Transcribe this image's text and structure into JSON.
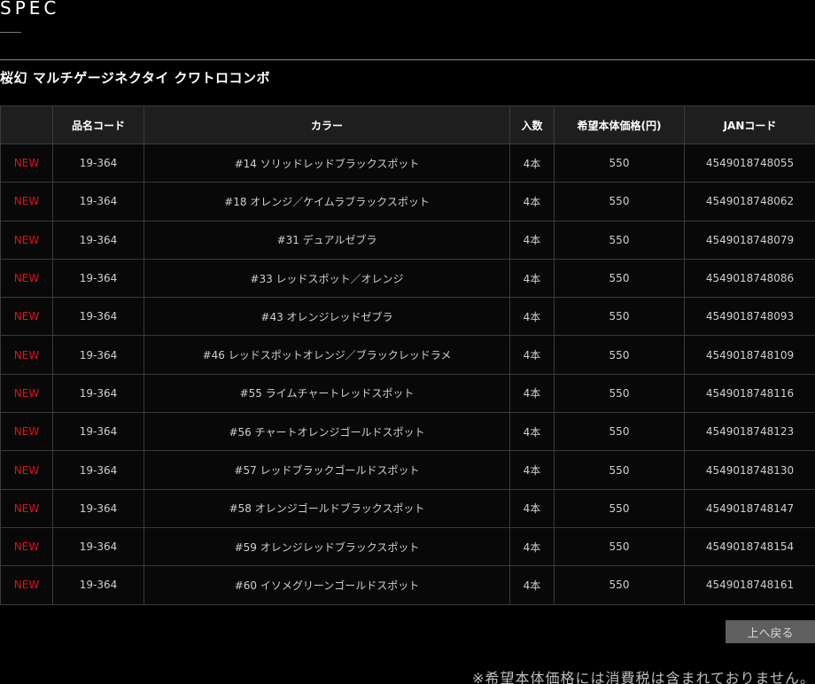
{
  "section": {
    "heading": "SPEC"
  },
  "product": {
    "title": "桜幻 マルチゲージネクタイ クワトロコンボ"
  },
  "table": {
    "headers": [
      "",
      "品名コード",
      "カラー",
      "入数",
      "希望本体価格(円)",
      "JANコード"
    ],
    "rows": [
      {
        "badge": "NEW",
        "code": "19-364",
        "color": "#14 ソリッドレッドブラックスポット",
        "qty": "4本",
        "price": "550",
        "jan": "4549018748055"
      },
      {
        "badge": "NEW",
        "code": "19-364",
        "color": "#18 オレンジ／ケイムラブラックスポット",
        "qty": "4本",
        "price": "550",
        "jan": "4549018748062"
      },
      {
        "badge": "NEW",
        "code": "19-364",
        "color": "#31 デュアルゼブラ",
        "qty": "4本",
        "price": "550",
        "jan": "4549018748079"
      },
      {
        "badge": "NEW",
        "code": "19-364",
        "color": "#33 レッドスポット／オレンジ",
        "qty": "4本",
        "price": "550",
        "jan": "4549018748086"
      },
      {
        "badge": "NEW",
        "code": "19-364",
        "color": "#43 オレンジレッドゼブラ",
        "qty": "4本",
        "price": "550",
        "jan": "4549018748093"
      },
      {
        "badge": "NEW",
        "code": "19-364",
        "color": "#46 レッドスポットオレンジ／ブラックレッドラメ",
        "qty": "4本",
        "price": "550",
        "jan": "4549018748109"
      },
      {
        "badge": "NEW",
        "code": "19-364",
        "color": "#55 ライムチャートレッドスポット",
        "qty": "4本",
        "price": "550",
        "jan": "4549018748116"
      },
      {
        "badge": "NEW",
        "code": "19-364",
        "color": "#56 チャートオレンジゴールドスポット",
        "qty": "4本",
        "price": "550",
        "jan": "4549018748123"
      },
      {
        "badge": "NEW",
        "code": "19-364",
        "color": "#57 レッドブラックゴールドスポット",
        "qty": "4本",
        "price": "550",
        "jan": "4549018748130"
      },
      {
        "badge": "NEW",
        "code": "19-364",
        "color": "#58 オレンジゴールドブラックスポット",
        "qty": "4本",
        "price": "550",
        "jan": "4549018748147"
      },
      {
        "badge": "NEW",
        "code": "19-364",
        "color": "#59 オレンジレッドブラックスポット",
        "qty": "4本",
        "price": "550",
        "jan": "4549018748154"
      },
      {
        "badge": "NEW",
        "code": "19-364",
        "color": "#60 イソメグリーンゴールドスポット",
        "qty": "4本",
        "price": "550",
        "jan": "4549018748161"
      }
    ]
  },
  "back_to_top": {
    "label": "上へ戻る"
  },
  "footer": {
    "note": "※希望本体価格には消費税は含まれておりません。"
  },
  "colors": {
    "badge_new": "#e3101a",
    "background": "#000000",
    "header_bg": "#1e1e1e",
    "button_bg": "#5f5f5f"
  }
}
